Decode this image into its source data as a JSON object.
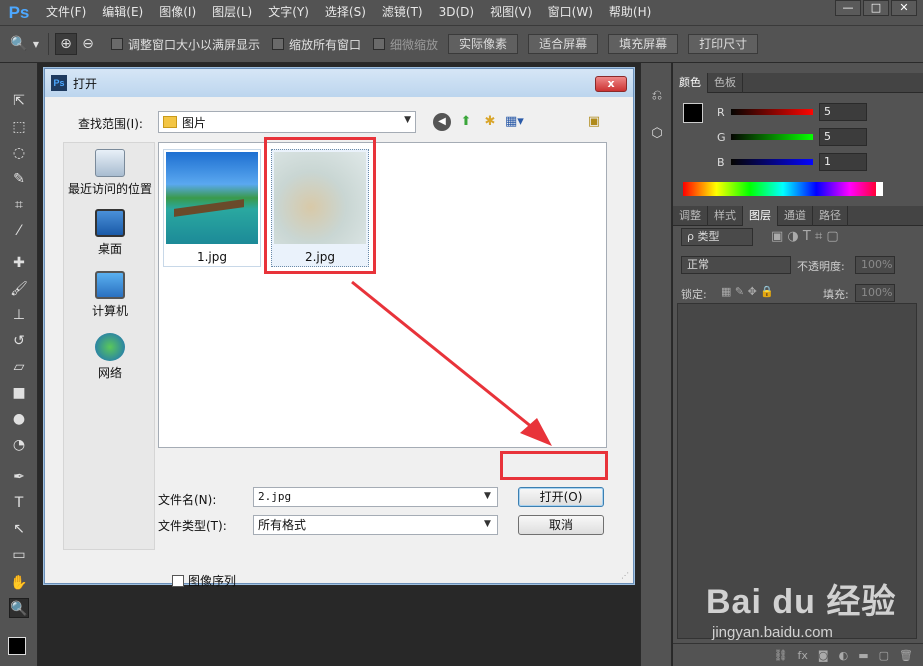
{
  "app": {
    "logo": "Ps",
    "menu": [
      "文件(F)",
      "编辑(E)",
      "图像(I)",
      "图层(L)",
      "文字(Y)",
      "选择(S)",
      "滤镜(T)",
      "3D(D)",
      "视图(V)",
      "窗口(W)",
      "帮助(H)"
    ],
    "window_buttons": [
      "—",
      "□",
      "✕"
    ]
  },
  "options": {
    "check_resize": "调整窗口大小以满屏显示",
    "check_zoom_all": "缩放所有窗口",
    "check_scrubby": "细微缩放",
    "btn_actual": "实际像素",
    "btn_fit": "适合屏幕",
    "btn_fill": "填充屏幕",
    "btn_print": "打印尺寸"
  },
  "color_panel": {
    "tabs": [
      "颜色",
      "色板"
    ],
    "r_label": "R",
    "r_value": "5",
    "g_label": "G",
    "g_value": "5",
    "b_label": "B",
    "b_value": "1"
  },
  "layers_panel": {
    "tabs": [
      "调整",
      "样式",
      "图层",
      "通道",
      "路径"
    ],
    "filter_kind": "ρ 类型",
    "blend_mode": "正常",
    "opacity_label": "不透明度:",
    "opacity_value": "100%",
    "lock_label": "锁定:",
    "fill_label": "填充:",
    "fill_value": "100%"
  },
  "dialog": {
    "title": "打开",
    "close": "x",
    "look_in_label": "查找范围(I):",
    "look_in_value": "图片",
    "places": [
      "最近访问的位置",
      "桌面",
      "计算机",
      "网络"
    ],
    "files": [
      "1.jpg",
      "2.jpg"
    ],
    "filename_label": "文件名(N):",
    "filename_value": "2.jpg",
    "filetype_label": "文件类型(T):",
    "filetype_value": "所有格式",
    "open_btn": "打开(O)",
    "cancel_btn": "取消",
    "image_sequence": "图像序列"
  },
  "watermark": {
    "main": "Bai du 经验",
    "sub": "jingyan.baidu.com"
  },
  "colors": {
    "annotation_red": "#e8333a",
    "ps_blue": "#4da8ff"
  }
}
